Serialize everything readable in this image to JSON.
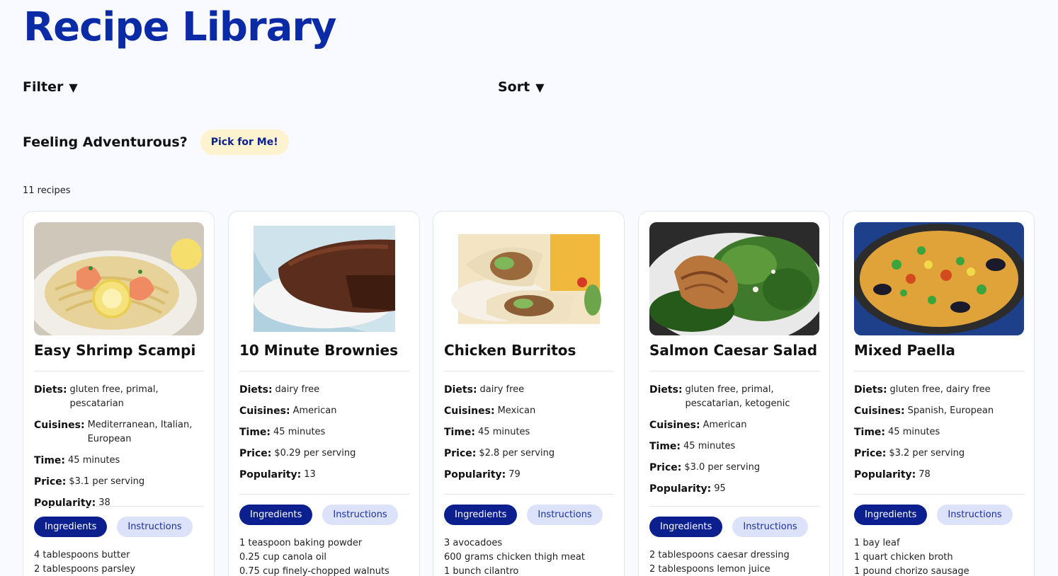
{
  "title": "Recipe Library",
  "filter_label": "Filter",
  "sort_label": "Sort",
  "caret": "▼",
  "adventure_label": "Feeling Adventurous?",
  "pick_button": "Pick for Me!",
  "recipe_count": "11 recipes",
  "labels": {
    "diets": "Diets:",
    "cuisines": "Cuisines:",
    "time": "Time:",
    "price": "Price:",
    "popularity": "Popularity:",
    "ingredients_tab": "Ingredients",
    "instructions_tab": "Instructions"
  },
  "recipes": [
    {
      "name": "Easy Shrimp Scampi",
      "diets": "gluten free, primal, pescatarian",
      "cuisines": "Mediterranean, Italian, European",
      "time": "45 minutes",
      "price": "$3.1 per serving",
      "popularity": "38",
      "ingredients": [
        "4 tablespoons butter",
        "2 tablespoons parsley"
      ]
    },
    {
      "name": "10 Minute Brownies",
      "diets": "dairy free",
      "cuisines": "American",
      "time": "45 minutes",
      "price": "$0.29 per serving",
      "popularity": "13",
      "ingredients": [
        "1 teaspoon baking powder",
        "0.25 cup canola oil",
        "0.75 cup finely-chopped walnuts"
      ]
    },
    {
      "name": "Chicken Burritos",
      "diets": "dairy free",
      "cuisines": "Mexican",
      "time": "45 minutes",
      "price": "$2.8 per serving",
      "popularity": "79",
      "ingredients": [
        "3 avocadoes",
        "600 grams chicken thigh meat",
        "1 bunch cilantro"
      ]
    },
    {
      "name": "Salmon Caesar Salad",
      "diets": "gluten free, primal, pescatarian, ketogenic",
      "cuisines": "American",
      "time": "45 minutes",
      "price": "$3.0 per serving",
      "popularity": "95",
      "ingredients": [
        "2 tablespoons caesar dressing",
        "2 tablespoons lemon juice"
      ]
    },
    {
      "name": "Mixed Paella",
      "diets": "gluten free, dairy free",
      "cuisines": "Spanish, European",
      "time": "45 minutes",
      "price": "$3.2 per serving",
      "popularity": "78",
      "ingredients": [
        "1 bay leaf",
        "1 quart chicken broth",
        "1 pound chorizo sausage"
      ]
    }
  ],
  "colors": {
    "title": "#0a2aa6",
    "pick_bg": "#fdf3cf",
    "tab_active": "#0b1f8f",
    "tab_inactive": "#dde2fb"
  }
}
